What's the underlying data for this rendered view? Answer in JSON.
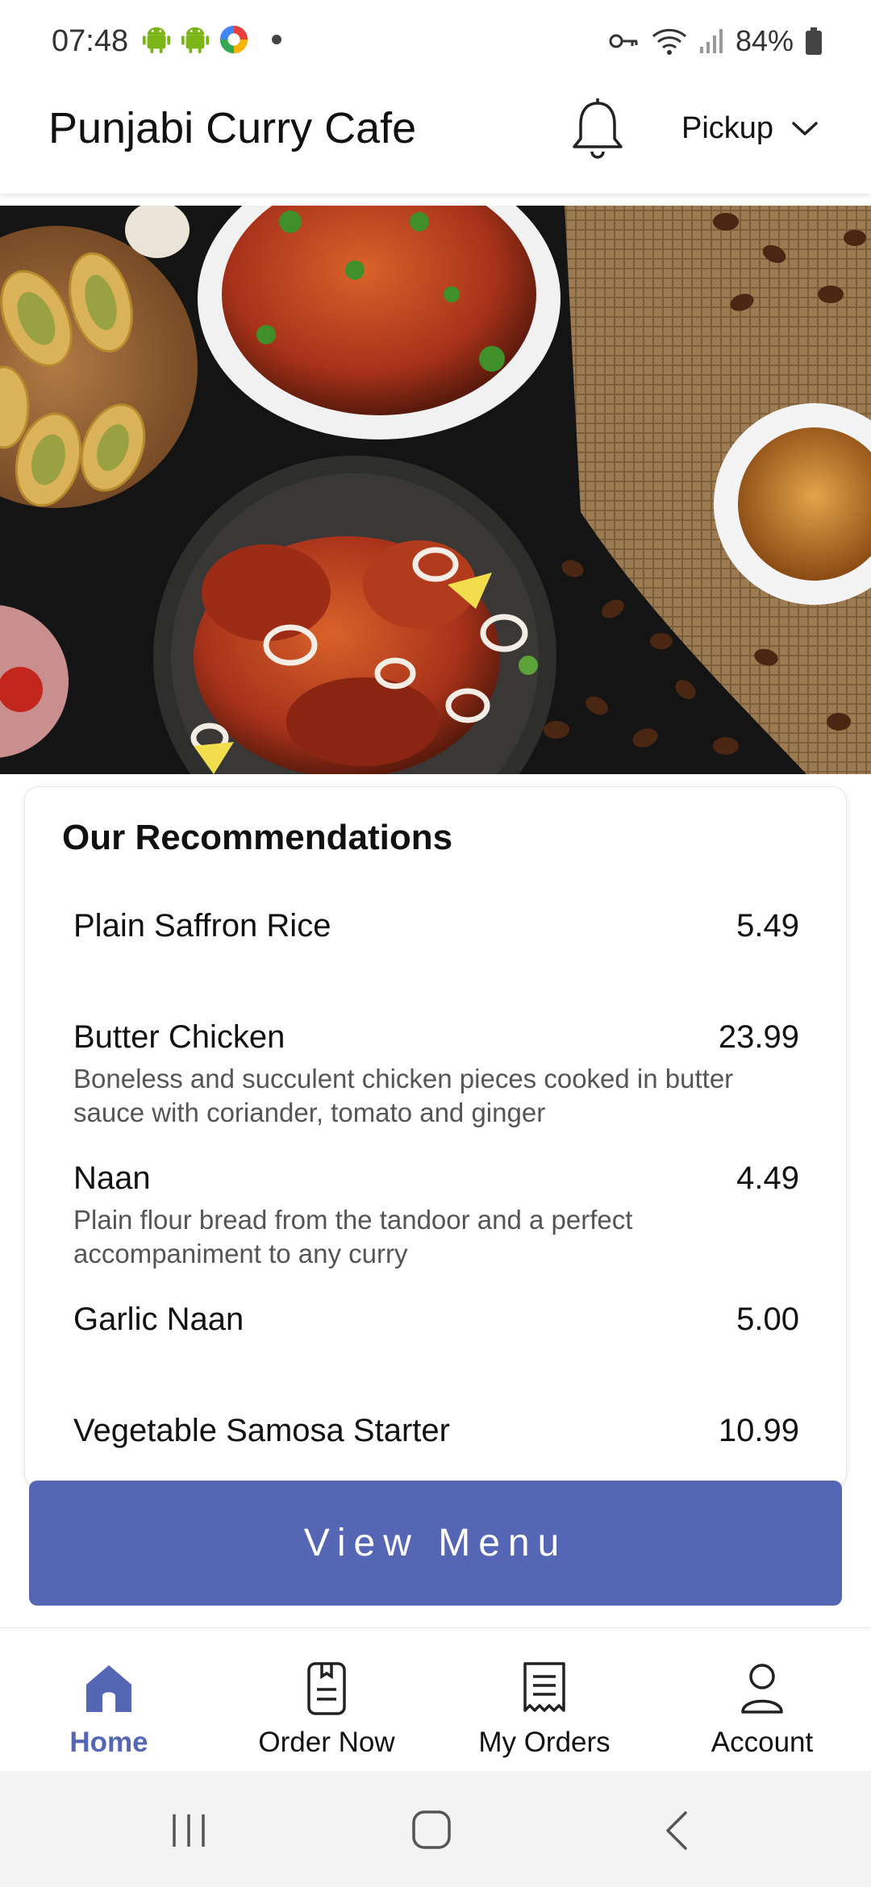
{
  "status_bar": {
    "time": "07:48",
    "battery": "84%",
    "icons": [
      "android-icon",
      "android-icon",
      "app-badge-icon",
      "key-icon",
      "wifi-icon",
      "signal-icon",
      "battery-icon"
    ]
  },
  "header": {
    "title": "Punjabi Curry Cafe",
    "order_mode": "Pickup"
  },
  "recommendations": {
    "title": "Our Recommendations",
    "items": [
      {
        "name": "Plain Saffron Rice",
        "price": "5.49",
        "description": ""
      },
      {
        "name": "Butter Chicken",
        "price": "23.99",
        "description": "Boneless and succulent chicken pieces cooked in butter sauce with coriander, tomato and ginger"
      },
      {
        "name": "Naan",
        "price": "4.49",
        "description": "Plain flour bread from the tandoor and a perfect accompaniment to any curry"
      },
      {
        "name": "Garlic Naan",
        "price": "5.00",
        "description": ""
      },
      {
        "name": "Vegetable Samosa Starter",
        "price": "10.99",
        "description": ""
      }
    ]
  },
  "cta": {
    "view_menu": "View Menu"
  },
  "bottom_nav": {
    "items": [
      {
        "label": "Home",
        "icon": "home-icon",
        "active": true
      },
      {
        "label": "Order Now",
        "icon": "order-book-icon",
        "active": false
      },
      {
        "label": "My Orders",
        "icon": "receipt-icon",
        "active": false
      },
      {
        "label": "Account",
        "icon": "person-icon",
        "active": false
      }
    ]
  },
  "colors": {
    "accent": "#5566b5",
    "text": "#111111",
    "muted": "#555555"
  }
}
